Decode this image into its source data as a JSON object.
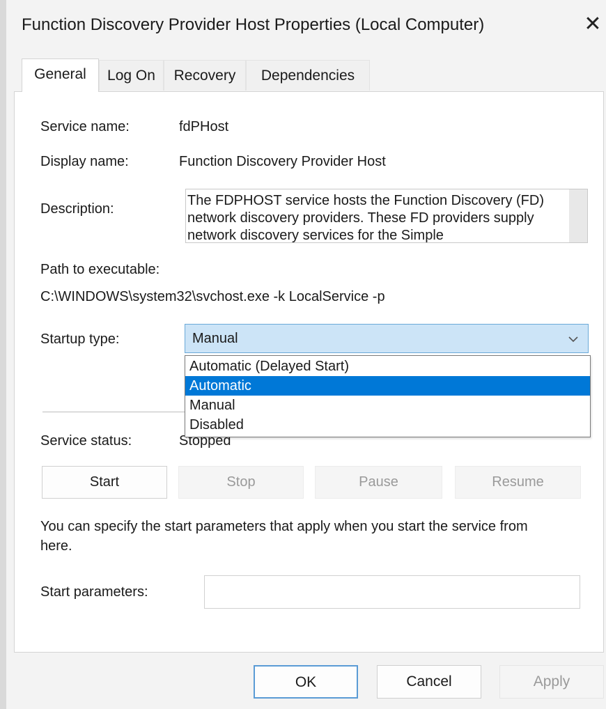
{
  "window": {
    "title": "Function Discovery Provider Host Properties (Local Computer)",
    "close_glyph": "✕"
  },
  "tabs": [
    {
      "label": "General",
      "active": true
    },
    {
      "label": "Log On",
      "active": false
    },
    {
      "label": "Recovery",
      "active": false
    },
    {
      "label": "Dependencies",
      "active": false
    }
  ],
  "general": {
    "service_name_label": "Service name:",
    "service_name_value": "fdPHost",
    "display_name_label": "Display name:",
    "display_name_value": "Function Discovery Provider Host",
    "description_label": "Description:",
    "description_value": "The FDPHOST service hosts the Function Discovery (FD) network discovery providers. These FD providers supply network discovery services for the Simple",
    "path_label": "Path to executable:",
    "path_value": "C:\\WINDOWS\\system32\\svchost.exe -k LocalService -p",
    "startup_label": "Startup type:",
    "startup_value": "Manual",
    "startup_options": [
      "Automatic (Delayed Start)",
      "Automatic",
      "Manual",
      "Disabled"
    ],
    "startup_highlighted": "Automatic",
    "status_label": "Service status:",
    "status_value": "Stopped"
  },
  "service_buttons": {
    "start": "Start",
    "stop": "Stop",
    "pause": "Pause",
    "resume": "Resume"
  },
  "start_params": {
    "description": "You can specify the start parameters that apply when you start the service from here.",
    "label": "Start parameters:",
    "value": ""
  },
  "footer": {
    "ok": "OK",
    "cancel": "Cancel",
    "apply": "Apply"
  },
  "colors": {
    "accent": "#0078d7",
    "select_bg": "#cce4f7",
    "disabled_text": "#9a9a9a"
  }
}
